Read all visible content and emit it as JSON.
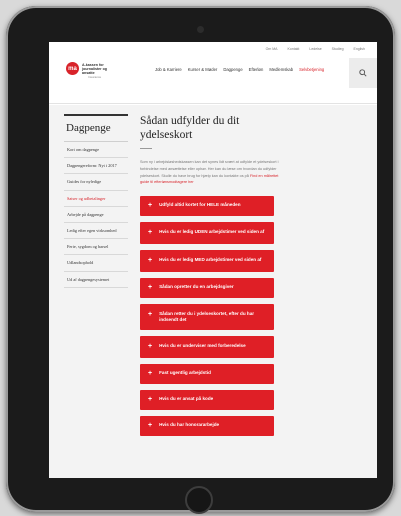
{
  "util_nav": [
    "Om MA",
    "Kontakt",
    "Ledelse",
    "Studieg",
    "English"
  ],
  "logo": {
    "mark": "ma",
    "name": "A-kassen for journalister og ansatte",
    "tag": "Insurance"
  },
  "main_nav": [
    {
      "label": "Job & Karriere",
      "active": false
    },
    {
      "label": "Kurser & Møder",
      "active": false
    },
    {
      "label": "Dagpenge",
      "active": false
    },
    {
      "label": "Efterløn",
      "active": false
    },
    {
      "label": "Medlemskab",
      "active": false
    },
    {
      "label": "Selvbetjening",
      "active": true
    }
  ],
  "sidebar": {
    "title": "Dagpenge",
    "items": [
      {
        "label": "Kort om dagpenge",
        "active": false
      },
      {
        "label": "Dagpengereform: Nyt i 2017",
        "active": false
      },
      {
        "label": "Guides for nyledige",
        "active": false
      },
      {
        "label": "Satser og udbetalinger",
        "active": true
      },
      {
        "label": "Arbejde på dagpenge",
        "active": false
      },
      {
        "label": "Ledig efter egen virksomhed",
        "active": false
      },
      {
        "label": "Ferie, sygdom og barsel",
        "active": false
      },
      {
        "label": "Udlandsophold",
        "active": false
      },
      {
        "label": "Ud af dagpengesystemet",
        "active": false
      }
    ]
  },
  "main": {
    "title": "Sådan udfylder du dit ydelseskort",
    "intro": "Som ny i arbejdsløshedskassen kan det synes lidt svært at udfylde et ydelseskort i forbindelse med ansættelse eller ophør. Her kan du læse om hvordan du udfylder ydelseskort. Skulle du have brug for hjælp kan du kontakte os på",
    "intro_link": "Find en målrettet guide til efterlønsmodtagere her",
    "accordion": [
      "Udfyld altid kortet for HELE måneden",
      "Hvis du er ledig UDEN arbejdstimer ved siden af",
      "Hvis du er ledig MED arbejdstimer ved siden af",
      "Sådan opretter du en arbejdsgiver",
      "Sådan retter du i ydelseskortet, efter du har indsendt det",
      "Hvis du er underviser med forberedelse",
      "Fast ugentlig arbejdstid",
      "Hvis du er ansat på kode",
      "Hvis du har honorararbejde"
    ]
  }
}
